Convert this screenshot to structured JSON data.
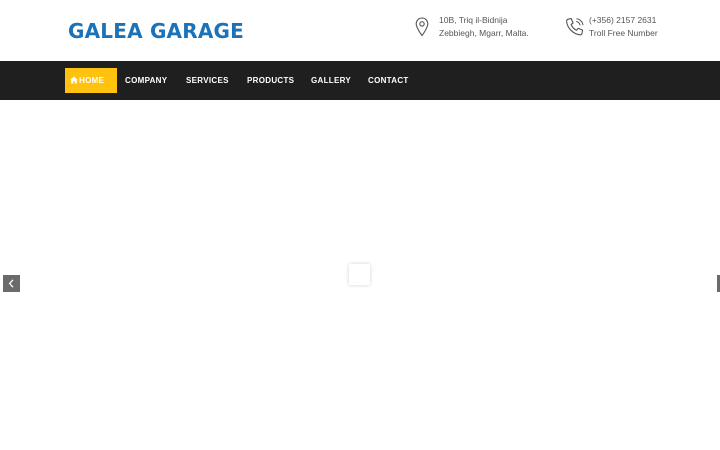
{
  "brand": {
    "name": "GALEA GARAGE",
    "color": "#1b72b8"
  },
  "contact": {
    "address": {
      "icon": "map-pin-icon",
      "line1": "10B, Triq il-Bidnija",
      "line2": "Zebbiegh, Mgarr, Malta."
    },
    "phone": {
      "icon": "phone-icon",
      "line1": "(+356) 2157 2631",
      "line2": "Troll Free Number"
    }
  },
  "nav": {
    "accent_color": "#ffc20e",
    "background_color": "#1f1f1f",
    "items": [
      {
        "label": "HOME",
        "icon": "home-icon",
        "active": true
      },
      {
        "label": "COMPANY",
        "active": false
      },
      {
        "label": "SERVICES",
        "active": false
      },
      {
        "label": "PRODUCTS",
        "active": false
      },
      {
        "label": "GALLERY",
        "active": false
      },
      {
        "label": "CONTACT",
        "active": false
      }
    ]
  },
  "slider": {
    "prev_icon": "chevron-left-icon",
    "next_icon": "chevron-right-icon",
    "loading_icon": "loading-spinner-icon"
  }
}
